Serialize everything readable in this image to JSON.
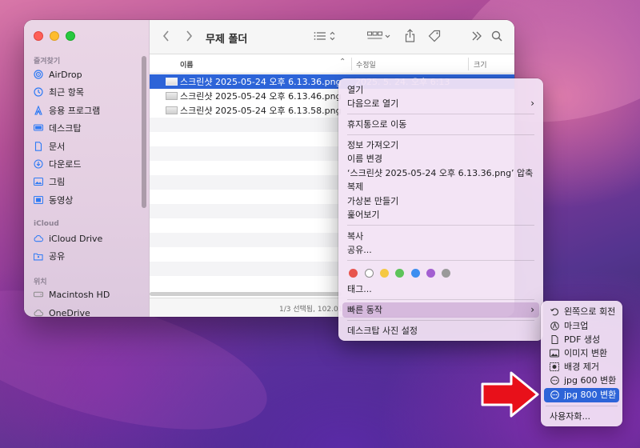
{
  "finder": {
    "title": "무제 폴더",
    "sidebar": {
      "favorites_label": "즐겨찾기",
      "favorites": [
        {
          "label": "AirDrop",
          "icon": "airdrop-icon"
        },
        {
          "label": "최근 항목",
          "icon": "clock-icon"
        },
        {
          "label": "응용 프로그램",
          "icon": "applications-icon"
        },
        {
          "label": "데스크탑",
          "icon": "desktop-icon"
        },
        {
          "label": "문서",
          "icon": "document-icon"
        },
        {
          "label": "다운로드",
          "icon": "download-icon"
        },
        {
          "label": "그림",
          "icon": "pictures-icon"
        },
        {
          "label": "동영상",
          "icon": "movies-icon"
        }
      ],
      "icloud_label": "iCloud",
      "icloud": [
        {
          "label": "iCloud Drive",
          "icon": "cloud-icon"
        },
        {
          "label": "공유",
          "icon": "shared-folder-icon"
        }
      ],
      "locations_label": "위치",
      "locations": [
        {
          "label": "Macintosh HD",
          "icon": "disk-icon"
        },
        {
          "label": "OneDrive",
          "icon": "cloud-icon"
        }
      ]
    },
    "columns": {
      "name": "이름",
      "modified": "수정일",
      "size": "크기"
    },
    "files": [
      {
        "name": "스크린샷 2025-05-24 오후 6.13.36.png",
        "modified": "2025. 5. 24. 오후 6:13",
        "selected": true
      },
      {
        "name": "스크린샷 2025-05-24 오후 6.13.46.png",
        "modified": "",
        "selected": false
      },
      {
        "name": "스크린샷 2025-05-24 오후 6.13.58.png",
        "modified": "",
        "selected": false
      }
    ],
    "status": "1/3 선택됨, 102.01"
  },
  "context_menu": {
    "open": "열기",
    "open_with": "다음으로 열기",
    "move_to_trash": "휴지통으로 이동",
    "get_info": "정보 가져오기",
    "rename": "이름 변경",
    "compress": "‘스크린샷 2025-05-24 오후 6.13.36.png’ 압축",
    "duplicate": "복제",
    "make_alias": "가상본 만들기",
    "quick_look": "훑어보기",
    "copy": "복사",
    "share": "공유...",
    "tags_label": "태그...",
    "tag_colors": [
      "#e8554e",
      "#ffffff",
      "#f5c843",
      "#5dc35a",
      "#3d8ef0",
      "#a35fd1",
      "#9a9a9a"
    ],
    "quick_actions": "빠른 동작",
    "set_desktop": "데스크탑 사진 설정"
  },
  "quick_actions_menu": {
    "items": [
      {
        "label": "왼쪽으로 회전",
        "icon": "rotate-left-icon"
      },
      {
        "label": "마크업",
        "icon": "markup-icon"
      },
      {
        "label": "PDF 생성",
        "icon": "pdf-icon"
      },
      {
        "label": "이미지 변환",
        "icon": "image-convert-icon"
      },
      {
        "label": "배경 제거",
        "icon": "remove-background-icon"
      },
      {
        "label": "jpg 600 변환",
        "icon": "workflow-icon"
      },
      {
        "label": "jpg 800 변환",
        "icon": "workflow-icon",
        "selected": true
      }
    ],
    "customize": "사용자화..."
  },
  "colors": {
    "accent": "#2d64d8",
    "arrow": "#e8101a"
  }
}
